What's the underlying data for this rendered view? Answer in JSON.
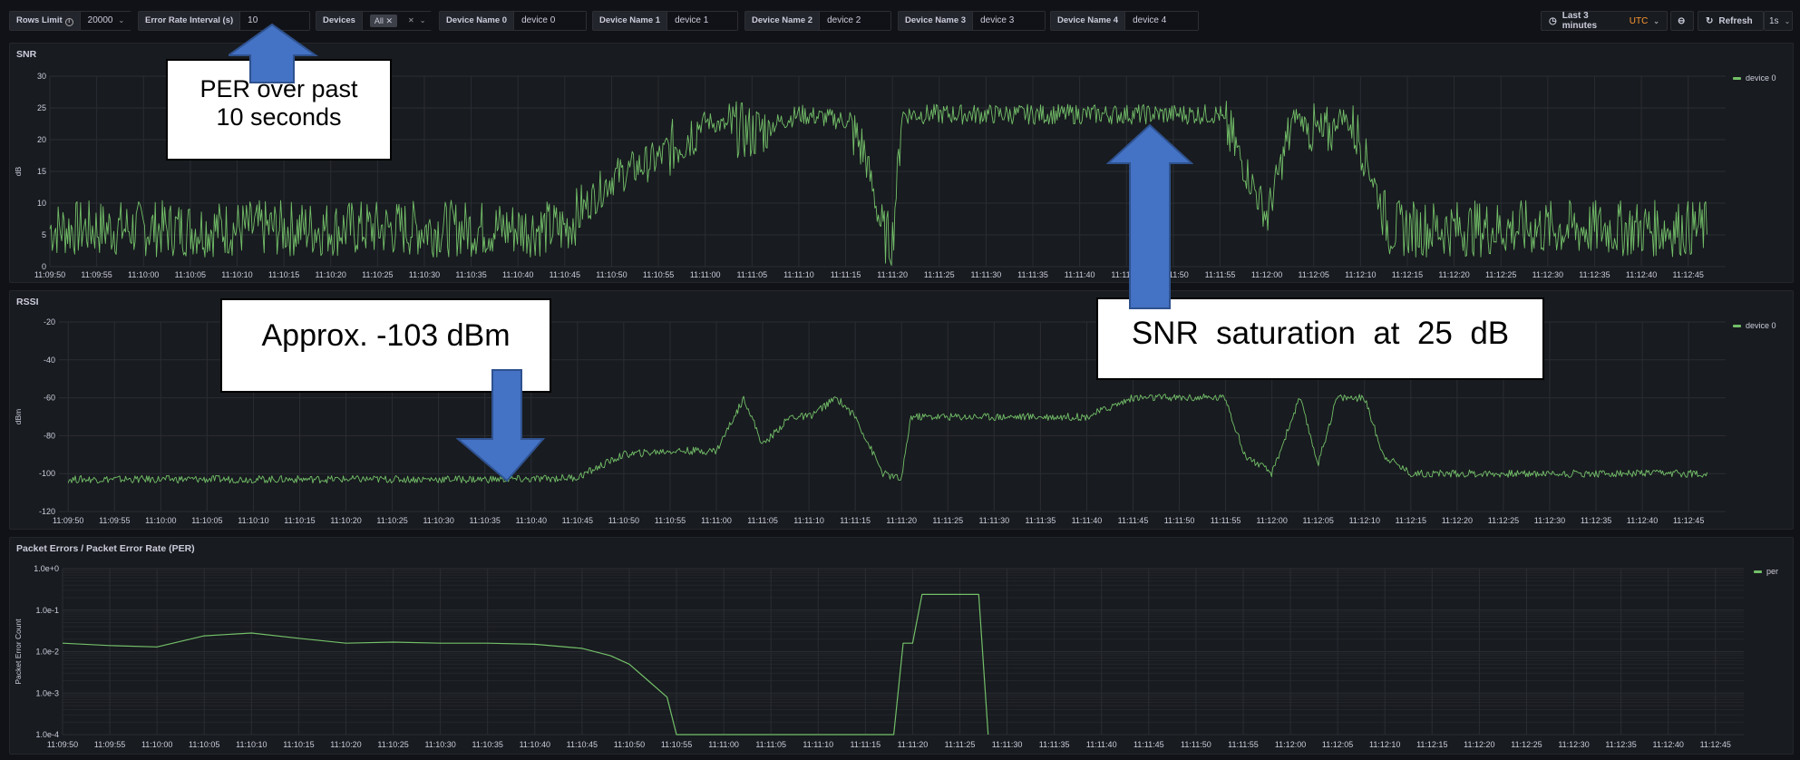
{
  "variables": {
    "rows_limit": {
      "label": "Rows Limit",
      "value": "20000"
    },
    "error_rate": {
      "label": "Error Rate Interval (s)",
      "value": "10"
    },
    "devices": {
      "label": "Devices",
      "value": "All"
    },
    "dev0": {
      "label": "Device Name 0",
      "value": "device 0"
    },
    "dev1": {
      "label": "Device Name 1",
      "value": "device 1"
    },
    "dev2": {
      "label": "Device Name 2",
      "value": "device 2"
    },
    "dev3": {
      "label": "Device Name 3",
      "value": "device 3"
    },
    "dev4": {
      "label": "Device Name 4",
      "value": "device 4"
    }
  },
  "toolbar": {
    "time_range": "Last 3 minutes",
    "timezone": "UTC",
    "refresh": "Refresh",
    "refresh_interval": "1s"
  },
  "annotations": {
    "per": [
      "PER over past",
      "10 seconds"
    ],
    "rssi": "Approx. -103 dBm",
    "snr": "SNR  saturation  at  25  dB"
  },
  "colors": {
    "series": "#73bf69",
    "accent_orange": "#ff9830",
    "arrow": "#4472c4"
  },
  "time_ticks": [
    "11:09:50",
    "11:09:55",
    "11:10:00",
    "11:10:05",
    "11:10:10",
    "11:10:15",
    "11:10:20",
    "11:10:25",
    "11:10:30",
    "11:10:35",
    "11:10:40",
    "11:10:45",
    "11:10:50",
    "11:10:55",
    "11:11:00",
    "11:11:05",
    "11:11:10",
    "11:11:15",
    "11:11:20",
    "11:11:25",
    "11:11:30",
    "11:11:35",
    "11:11:40",
    "11:11:45",
    "11:11:50",
    "11:11:55",
    "11:12:00",
    "11:12:05",
    "11:12:10",
    "11:12:15",
    "11:12:20",
    "11:12:25",
    "11:12:30",
    "11:12:35",
    "11:12:40",
    "11:12:45"
  ],
  "chart_data": [
    {
      "type": "line",
      "title": "SNR",
      "ylabel": "dB",
      "ylim": [
        0,
        30
      ],
      "yticks": [
        "0",
        "5",
        "10",
        "15",
        "20",
        "25",
        "30"
      ],
      "legend": "top-right",
      "grid": true,
      "series": [
        {
          "name": "device 0",
          "x": [
            "11:09:50",
            "11:10:00",
            "11:10:10",
            "11:10:20",
            "11:10:30",
            "11:10:40",
            "11:10:45",
            "11:10:50",
            "11:10:55",
            "11:11:00",
            "11:11:05",
            "11:11:10",
            "11:11:15",
            "11:11:17",
            "11:11:19",
            "11:11:20",
            "11:11:21",
            "11:11:25",
            "11:11:35",
            "11:11:45",
            "11:11:55",
            "11:12:00",
            "11:12:03",
            "11:12:06",
            "11:12:08",
            "11:12:10",
            "11:12:13",
            "11:12:15",
            "11:12:25",
            "11:12:35",
            "11:12:45",
            "11:12:47"
          ],
          "values": [
            6,
            6,
            6,
            6,
            6,
            6,
            6,
            14,
            17,
            23,
            21,
            24,
            23,
            18,
            5,
            4,
            24,
            24,
            24,
            24,
            24,
            8,
            24,
            20,
            24,
            20,
            6,
            6,
            6,
            6,
            6,
            6
          ]
        }
      ]
    },
    {
      "type": "line",
      "title": "RSSI",
      "ylabel": "dBm",
      "ylim": [
        -120,
        -20
      ],
      "yticks": [
        "-120",
        "-100",
        "-80",
        "-60",
        "-40",
        "-20"
      ],
      "legend": "top-right",
      "grid": true,
      "series": [
        {
          "name": "device 0",
          "x": [
            "11:09:50",
            "11:10:00",
            "11:10:10",
            "11:10:20",
            "11:10:30",
            "11:10:40",
            "11:10:45",
            "11:10:50",
            "11:10:55",
            "11:11:00",
            "11:11:03",
            "11:11:05",
            "11:11:08",
            "11:11:10",
            "11:11:13",
            "11:11:15",
            "11:11:18",
            "11:11:20",
            "11:11:21",
            "11:11:30",
            "11:11:40",
            "11:11:45",
            "11:11:55",
            "11:11:57",
            "11:12:00",
            "11:12:03",
            "11:12:05",
            "11:12:07",
            "11:12:10",
            "11:12:12",
            "11:12:15",
            "11:12:25",
            "11:12:35",
            "11:12:45",
            "11:12:47"
          ],
          "values": [
            -103,
            -103,
            -103,
            -103,
            -103,
            -103,
            -102,
            -90,
            -88,
            -88,
            -60,
            -85,
            -70,
            -70,
            -60,
            -70,
            -100,
            -103,
            -70,
            -70,
            -70,
            -60,
            -60,
            -90,
            -100,
            -60,
            -95,
            -60,
            -60,
            -90,
            -100,
            -100,
            -100,
            -100,
            -100
          ]
        }
      ]
    },
    {
      "type": "line",
      "title": "Packet Errors / Packet Error Rate (PER)",
      "ylabel": "Packet Error Count",
      "yscale": "log",
      "ylim": [
        0.0001,
        1
      ],
      "yticks": [
        "1.0e-4",
        "1.0e-3",
        "1.0e-2",
        "1.0e-1",
        "1.0e+0"
      ],
      "legend": "top-right",
      "grid": true,
      "series": [
        {
          "name": "per",
          "x": [
            "11:09:50",
            "11:09:55",
            "11:10:00",
            "11:10:05",
            "11:10:10",
            "11:10:15",
            "11:10:20",
            "11:10:25",
            "11:10:30",
            "11:10:35",
            "11:10:40",
            "11:10:45",
            "11:10:48",
            "11:10:50",
            "11:10:52",
            "11:10:54",
            "11:10:55",
            "11:11:18",
            "11:11:19",
            "11:11:20",
            "11:11:21",
            "11:11:27",
            "11:11:28"
          ],
          "values": [
            0.016,
            0.014,
            0.013,
            0.024,
            0.028,
            0.021,
            0.016,
            0.017,
            0.016,
            0.016,
            0.015,
            0.012,
            0.008,
            0.005,
            0.002,
            0.0008,
            0.0001,
            0.0001,
            0.016,
            0.016,
            0.24,
            0.24,
            0.0001
          ]
        }
      ]
    }
  ]
}
